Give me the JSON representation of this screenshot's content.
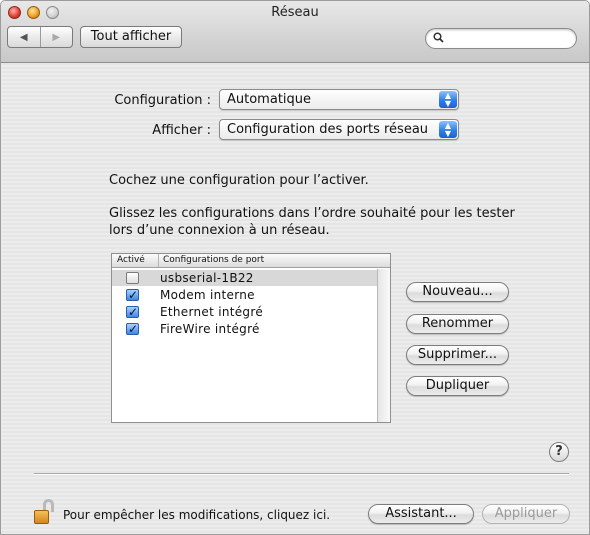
{
  "window": {
    "title": "Réseau"
  },
  "toolbar": {
    "show_all_label": "Tout afficher",
    "search_placeholder": "",
    "back_glyph": "◀",
    "forward_glyph": "▶",
    "search_glyph": "🔍"
  },
  "form": {
    "configuration_label": "Configuration :",
    "configuration_value": "Automatique",
    "show_label": "Afficher :",
    "show_value": "Configuration des ports réseau"
  },
  "instructions": {
    "line1": "Cochez une configuration pour l’activer.",
    "line2a": "Glissez les configurations dans l’ordre souhaité pour les tester",
    "line2b": "lors d’une connexion à un réseau."
  },
  "port_table": {
    "headers": {
      "active": "Activé",
      "config": "Configurations de port"
    },
    "rows": [
      {
        "name": "usbserial-1B22",
        "checked": false,
        "selected": true
      },
      {
        "name": "Modem interne",
        "checked": true,
        "selected": false
      },
      {
        "name": "Ethernet intégré",
        "checked": true,
        "selected": false
      },
      {
        "name": "FireWire intégré",
        "checked": true,
        "selected": false
      }
    ]
  },
  "buttons": {
    "new": "Nouveau...",
    "rename": "Renommer",
    "delete": "Supprimer...",
    "duplicate": "Dupliquer",
    "help": "?",
    "assistant": "Assistant...",
    "apply": "Appliquer"
  },
  "footer": {
    "lock_text": "Pour empêcher les modifications, cliquez ici."
  },
  "colors": {
    "accent": "#2f7fe8",
    "selection": "#d8d8d8"
  },
  "icons": {
    "close": "close-icon",
    "minimize": "minimize-icon",
    "zoom": "zoom-icon",
    "back": "back-arrow-icon",
    "forward": "forward-arrow-icon",
    "search": "search-icon",
    "popup": "popup-arrows-icon",
    "help": "help-icon",
    "lock": "lock-open-icon"
  }
}
